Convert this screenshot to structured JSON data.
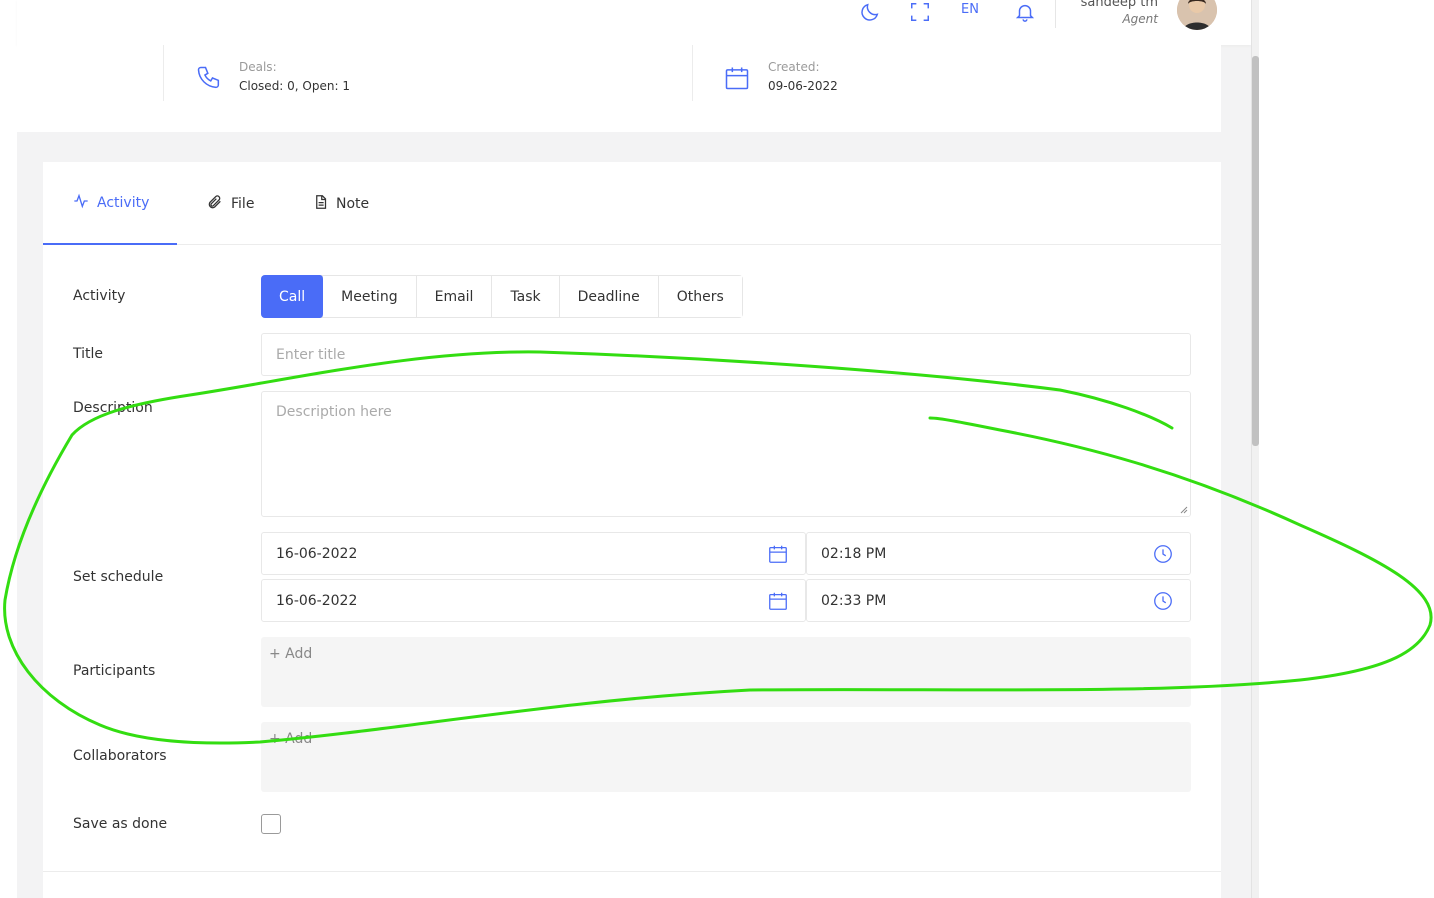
{
  "topbar": {
    "language": "EN",
    "user_name": "sandeep tm",
    "user_role": "Agent",
    "icons": [
      "moon-icon",
      "fullscreen-icon",
      "bell-icon"
    ]
  },
  "info": {
    "deals_label": "Deals:",
    "deals_value": "Closed: 0, Open: 1",
    "created_label": "Created:",
    "created_value": "09-06-2022"
  },
  "tabs": [
    {
      "label": "Activity",
      "icon": "activity-icon",
      "active": true
    },
    {
      "label": "File",
      "icon": "paperclip-icon",
      "active": false
    },
    {
      "label": "Note",
      "icon": "document-icon",
      "active": false
    }
  ],
  "form": {
    "activity_label": "Activity",
    "activity_types": [
      "Call",
      "Meeting",
      "Email",
      "Task",
      "Deadline",
      "Others"
    ],
    "activity_selected": "Call",
    "title_label": "Title",
    "title_placeholder": "Enter title",
    "description_label": "Description",
    "description_placeholder": "Description here",
    "schedule_label": "Set schedule",
    "start_date": "16-06-2022",
    "start_time": "02:18 PM",
    "end_date": "16-06-2022",
    "end_time": "02:33 PM",
    "participants_label": "Participants",
    "participants_add": "+ Add",
    "collaborators_label": "Collaborators",
    "collaborators_add": "+ Add",
    "save_done_label": "Save as done",
    "save_done_checked": false
  },
  "colors": {
    "accent": "#4a6cf7",
    "annotation": "#33dd11"
  }
}
